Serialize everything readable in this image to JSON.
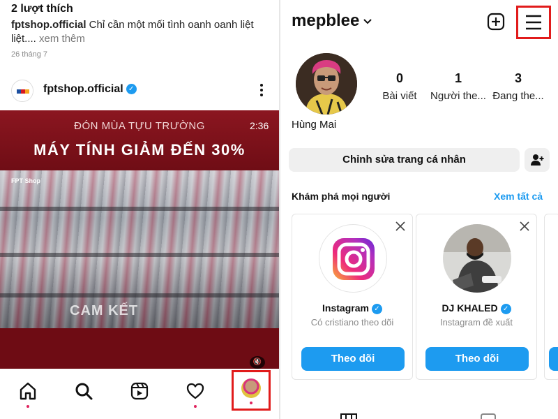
{
  "left_feed": {
    "likes": "2 lượt thích",
    "caption_user": "fptshop.official",
    "caption_text": "Chỉ cần một mối tình oanh oanh liệt liệt....",
    "caption_more": "xem thêm",
    "date": "26 tháng 7",
    "post_user": "fptshop.official",
    "promo_subtitle": "ĐÓN MÙA TỰU TRƯỜNG",
    "promo_title": "MÁY TÍNH GIẢM ĐẾN 30%",
    "video_timer": "2:36",
    "promo_overlay": "CAM KẾT",
    "photo_logo": "FPT Shop"
  },
  "bottom_nav": {
    "items": [
      "home-icon",
      "search-icon",
      "reels-icon",
      "heart-icon",
      "profile-avatar"
    ]
  },
  "profile": {
    "username": "mepblee",
    "display_name": "Hùng Mai",
    "stats": [
      {
        "value": "0",
        "label": "Bài viết"
      },
      {
        "value": "1",
        "label": "Người the..."
      },
      {
        "value": "3",
        "label": "Đang the..."
      }
    ],
    "edit_button": "Chỉnh sửa trang cá nhân"
  },
  "discover": {
    "title": "Khám phá mọi người",
    "see_all": "Xem tất cả",
    "cards": [
      {
        "name": "Instagram",
        "subtitle": "Có cristiano theo dõi",
        "button": "Theo dõi"
      },
      {
        "name": "DJ KHALED",
        "subtitle": "Instagram đề xuất",
        "button": "Theo dõi"
      }
    ]
  },
  "colors": {
    "accent_blue": "#1d9bf0",
    "highlight_red": "#e11b1b",
    "promo_red": "#7d0f17"
  }
}
